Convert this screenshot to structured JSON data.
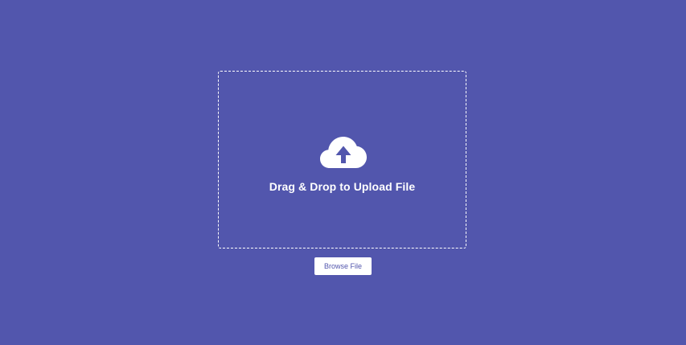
{
  "drop_zone": {
    "icon": "cloud-upload-icon",
    "text": "Drag & Drop to Upload File"
  },
  "browse_button": {
    "label": "Browse File"
  },
  "colors": {
    "background": "#5256ad",
    "foreground": "#ffffff"
  }
}
